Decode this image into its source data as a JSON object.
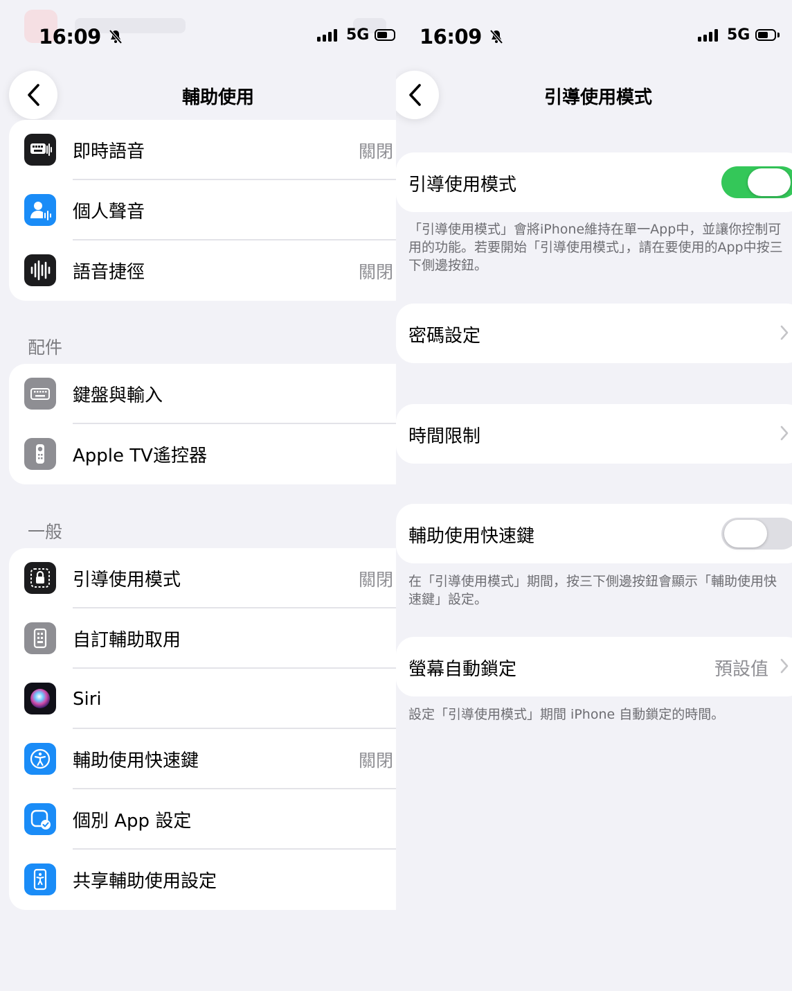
{
  "left": {
    "status": {
      "time": "16:09",
      "network": "5G"
    },
    "nav": {
      "title": "輔助使用"
    },
    "group1": [
      {
        "label": "即時語音",
        "value": "關閉",
        "icon": "keyboard-waveform-icon"
      },
      {
        "label": "個人聲音",
        "value": "",
        "icon": "person-voice-icon"
      },
      {
        "label": "語音捷徑",
        "value": "關閉",
        "icon": "waveform-icon"
      }
    ],
    "accessories": {
      "header": "配件",
      "items": [
        {
          "label": "鍵盤與輸入",
          "value": "",
          "icon": "keyboard-icon"
        },
        {
          "label": "Apple TV遙控器",
          "value": "",
          "icon": "tv-remote-icon"
        }
      ]
    },
    "general": {
      "header": "一般",
      "items": [
        {
          "label": "引導使用模式",
          "value": "關閉",
          "icon": "guided-access-lock-icon"
        },
        {
          "label": "自訂輔助取用",
          "value": "",
          "icon": "switch-control-icon"
        },
        {
          "label": "Siri",
          "value": "",
          "icon": "siri-icon"
        },
        {
          "label": "輔助使用快速鍵",
          "value": "關閉",
          "icon": "accessibility-icon"
        },
        {
          "label": "個別 App 設定",
          "value": "",
          "icon": "per-app-settings-icon"
        },
        {
          "label": "共享輔助使用設定",
          "value": "",
          "icon": "share-accessibility-icon"
        }
      ]
    }
  },
  "right": {
    "status": {
      "time": "16:09",
      "network": "5G"
    },
    "nav": {
      "title": "引導使用模式"
    },
    "guided_access": {
      "label": "引導使用模式",
      "enabled": true,
      "footer": "「引導使用模式」會將iPhone維持在單一App中，並讓你控制可用的功能。若要開始「引導使用模式」，請在要使用的App中按三下側邊按鈕。"
    },
    "passcode": {
      "label": "密碼設定"
    },
    "time_limits": {
      "label": "時間限制"
    },
    "shortcut": {
      "label": "輔助使用快速鍵",
      "enabled": false,
      "footer": "在「引導使用模式」期間，按三下側邊按鈕會顯示「輔助使用快速鍵」設定。"
    },
    "auto_lock": {
      "label": "螢幕自動鎖定",
      "value": "預設值",
      "footer": "設定「引導使用模式」期間 iPhone 自動鎖定的時間。"
    }
  },
  "colors": {
    "toggle_on": "#34c759",
    "background": "#f2f2f7",
    "blue_icon": "#1a8cf7"
  }
}
